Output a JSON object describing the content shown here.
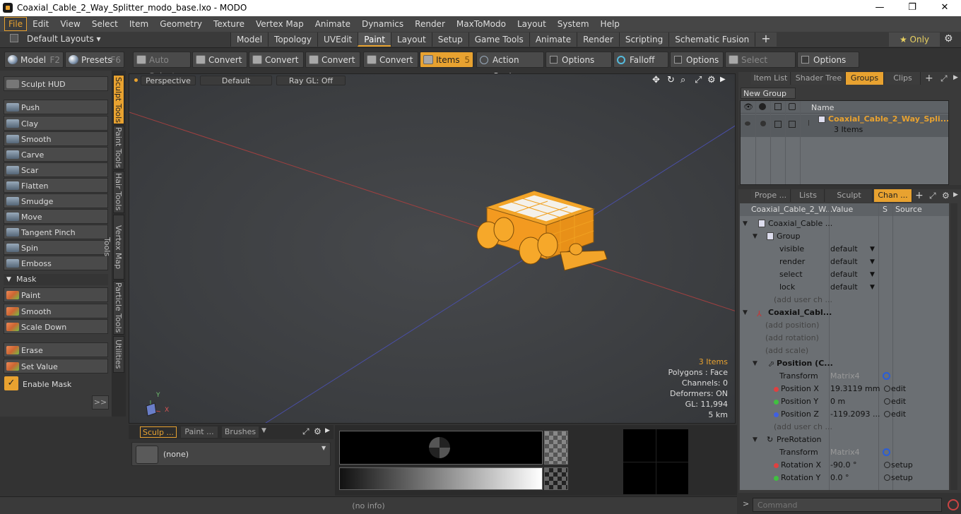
{
  "window": {
    "title": "Coaxial_Cable_2_Way_Splitter_modo_base.lxo - MODO",
    "minimize": "—",
    "maximize": "❐",
    "close": "✕"
  },
  "menu": [
    "File",
    "Edit",
    "View",
    "Select",
    "Item",
    "Geometry",
    "Texture",
    "Vertex Map",
    "Animate",
    "Dynamics",
    "Render",
    "MaxToModo",
    "Layout",
    "System",
    "Help"
  ],
  "layouts": {
    "default_label": "Default Layouts ▾",
    "tabs": [
      "Model",
      "Topology",
      "UVEdit",
      "Paint",
      "Layout",
      "Setup",
      "Game Tools",
      "Animate",
      "Render",
      "Scripting",
      "Schematic Fusion"
    ],
    "active_tab": "Paint",
    "plus": "+",
    "only": "★  Only",
    "gear": "⚙"
  },
  "toolbar": {
    "model": "Model",
    "model_key": "F2",
    "presets": "Presets",
    "presets_key": "F6",
    "auto_select": "Auto Select",
    "convert": "Convert",
    "items": "Items",
    "items_key": "5",
    "action_center": "Action Center",
    "options": "Options",
    "falloff": "Falloff",
    "select_through": "Select Through"
  },
  "sculpt": {
    "hud": "Sculpt HUD",
    "tools": [
      "Push",
      "Clay",
      "Smooth",
      "Carve",
      "Scar",
      "Flatten",
      "Smudge",
      "Move",
      "Tangent Pinch",
      "Spin",
      "Emboss"
    ],
    "mask_header": "Mask",
    "mask_tools": [
      "Paint",
      "Smooth",
      "Scale Down"
    ],
    "erase": "Erase",
    "set_value": "Set Value",
    "enable_mask": "Enable Mask",
    "expand": ">>"
  },
  "vtabs": [
    "Sculpt Tools",
    "Paint Tools",
    "Hair Tools",
    "Vertex Map Tools",
    "Particle Tools",
    "Utilities"
  ],
  "viewport": {
    "perspective": "Perspective",
    "default": "Default",
    "raygl": "Ray GL: Off",
    "stats": {
      "items": "3 Items",
      "polygons": "Polygons : Face",
      "channels": "Channels: 0",
      "deformers": "Deformers: ON",
      "gl": "GL: 11,994",
      "scale": "5 km"
    },
    "axis_y": "Y",
    "axis_x": "X"
  },
  "bottom": {
    "tabs": [
      "Sculp ...",
      "Paint ...",
      "Brushes"
    ],
    "brush_none": "(none)",
    "status": "(no info)"
  },
  "right_top": {
    "tabs": [
      "Item List",
      "Shader Tree",
      "Groups",
      "Clips"
    ],
    "active": "Groups",
    "new_group": "New Group",
    "col_name": "Name",
    "group_name": "Coaxial_Cable_2_Way_Spli...",
    "group_count": "3 Items"
  },
  "right_bottom": {
    "tabs": [
      "Prope ...",
      "Lists",
      "Sculpt",
      "Chan ..."
    ],
    "active": "Chan ...",
    "cols": {
      "name": "Coaxial_Cable_2_W...",
      "value": "Value",
      "s": "S",
      "source": "Source"
    },
    "rows": [
      {
        "name": "Coaxial_Cable ...",
        "value": "",
        "source": ""
      },
      {
        "name": "Group",
        "value": "",
        "source": ""
      },
      {
        "name": "visible",
        "value": "default",
        "source": ""
      },
      {
        "name": "render",
        "value": "default",
        "source": ""
      },
      {
        "name": "select",
        "value": "default",
        "source": ""
      },
      {
        "name": "lock",
        "value": "default",
        "source": ""
      },
      {
        "name": "(add user ch ...",
        "value": "",
        "source": ""
      },
      {
        "name": "Coaxial_Cabl...",
        "value": "",
        "source": ""
      },
      {
        "name": "(add position)",
        "value": "",
        "source": ""
      },
      {
        "name": "(add rotation)",
        "value": "",
        "source": ""
      },
      {
        "name": "(add scale)",
        "value": "",
        "source": ""
      },
      {
        "name": "Position (C...",
        "value": "",
        "source": ""
      },
      {
        "name": "Transform",
        "value": "Matrix4",
        "source": ""
      },
      {
        "name": "Position X",
        "value": "19.3119 mm",
        "source": "edit"
      },
      {
        "name": "Position Y",
        "value": "0 m",
        "source": "edit"
      },
      {
        "name": "Position Z",
        "value": "-119.2093 ...",
        "source": "edit"
      },
      {
        "name": "(add user ch ...",
        "value": "",
        "source": ""
      },
      {
        "name": "PreRotation",
        "value": "",
        "source": ""
      },
      {
        "name": "Transform",
        "value": "Matrix4",
        "source": ""
      },
      {
        "name": "Rotation X",
        "value": "-90.0 °",
        "source": "setup"
      },
      {
        "name": "Rotation Y",
        "value": "0.0 °",
        "source": "setup"
      }
    ],
    "command_placeholder": "Command"
  },
  "colors": {
    "accent": "#e8a230",
    "panel": "#3a3a3a",
    "list": "#6b6f73"
  }
}
